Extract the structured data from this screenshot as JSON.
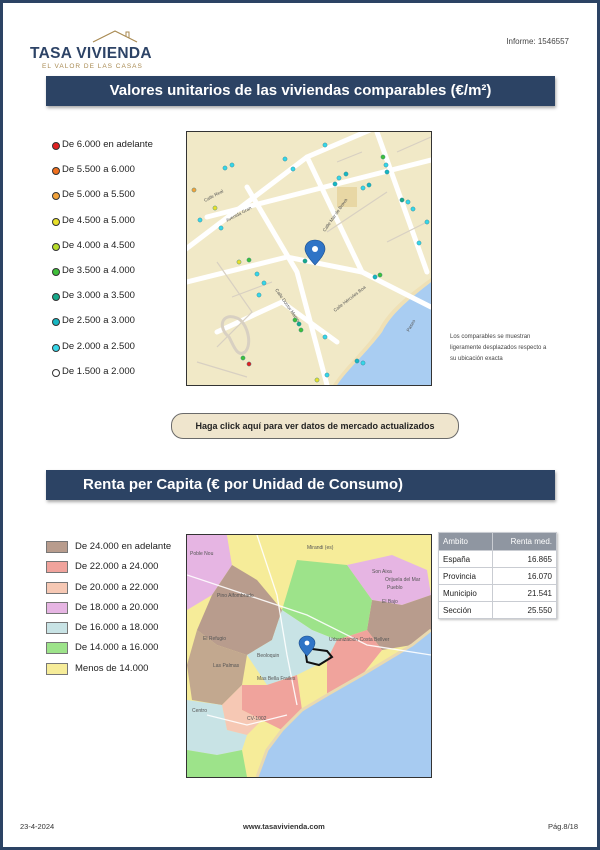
{
  "header": {
    "brand": "TASA VIVIENDA",
    "tagline": "EL VALOR DE LAS CASAS",
    "report_id": "Informe: 1546557"
  },
  "section1": {
    "title": "Valores unitarios de las viviendas comparables  (€/m²)",
    "legend": [
      {
        "label": "De 6.000 en adelante",
        "color": "#e02020"
      },
      {
        "label": "De 5.500 a 6.000",
        "color": "#f0701e"
      },
      {
        "label": "De 5.000 a 5.500",
        "color": "#f2a23a"
      },
      {
        "label": "De 4.500 a 5.000",
        "color": "#e8e02a"
      },
      {
        "label": "De 4.000 a 4.500",
        "color": "#b7dc2b"
      },
      {
        "label": "De 3.500 a 4.000",
        "color": "#3fbf3a"
      },
      {
        "label": "De 3.000 a 3.500",
        "color": "#18a88a"
      },
      {
        "label": "De 2.500 a 3.000",
        "color": "#17b7c2"
      },
      {
        "label": "De 2.000 a 2.500",
        "color": "#37d6e8"
      },
      {
        "label": "De 1.500 a 2.000",
        "color": "#ffffff"
      }
    ],
    "map": {
      "streets": [
        "Calle Real",
        "Avenida Gran",
        "Calle Mar de Brava",
        "Calle Doctor Marco",
        "Calle Hércules Boa",
        "Paseo"
      ],
      "subject_marker_color": "#2f74c6"
    },
    "note": "Los comparables se muestran ligeramente desplazados respecto a su ubicación exacta",
    "cta": "Haga click aquí para ver datos de mercado actualizados"
  },
  "section2": {
    "title": "Renta per Capita (€ por Unidad de Consumo)",
    "legend": [
      {
        "label": "De 24.000 en adelante",
        "color": "#b89c8d"
      },
      {
        "label": "De 22.000 a 24.000",
        "color": "#f0a39c"
      },
      {
        "label": "De 20.000 a 22.000",
        "color": "#f6c8b4"
      },
      {
        "label": "De 18.000 a 20.000",
        "color": "#e6b5e3"
      },
      {
        "label": "De 16.000 a 18.000",
        "color": "#c8e3e5"
      },
      {
        "label": "De 14.000 a 16.000",
        "color": "#9de38a"
      },
      {
        "label": "Menos de 14.000",
        "color": "#f6ec99"
      }
    ],
    "map_labels": [
      "Poble Nou",
      "Mirandi (es)",
      "Son Aixa",
      "Orijuela del Mar",
      "Pueblo",
      "El Bajo",
      "El Refugio",
      "Pino Alfombrado",
      "Urbanización Costa Bellver",
      "Beoloquin",
      "Las Palmas",
      "Mas Bella Frailes",
      "Centro",
      "CV-1002"
    ],
    "table": {
      "headers": [
        "Ambito",
        "Renta med."
      ],
      "rows": [
        {
          "name": "España",
          "value": "16.865"
        },
        {
          "name": "Provincia",
          "value": "16.070"
        },
        {
          "name": "Municipio",
          "value": "21.541"
        },
        {
          "name": "Sección",
          "value": "25.550"
        }
      ]
    }
  },
  "footer": {
    "date": "23-4-2024",
    "website": "www.tasavivienda.com",
    "page": "Pág.8/18"
  }
}
